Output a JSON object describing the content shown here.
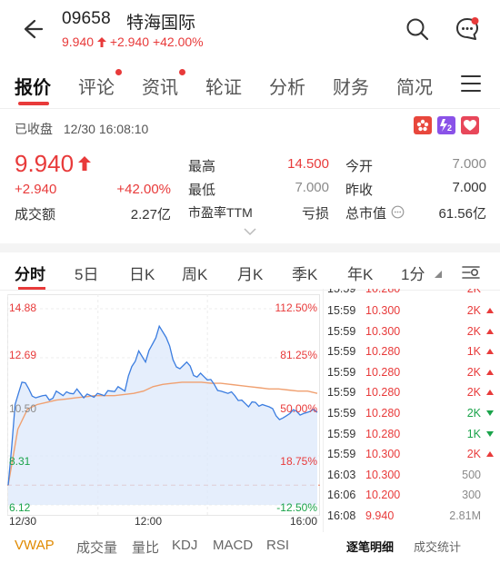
{
  "header": {
    "code": "09658",
    "name": "特海国际",
    "price": "9.940",
    "change": "+2.940",
    "change_pct": "+42.00%"
  },
  "tabs": [
    "报价",
    "评论",
    "资讯",
    "轮证",
    "分析",
    "财务",
    "简况"
  ],
  "status": {
    "text": "已收盘",
    "datetime": "12/30 16:08:10"
  },
  "quote": {
    "price": "9.940",
    "change": "+2.940",
    "change_pct": "+42.00%",
    "turnover_label": "成交额",
    "turnover": "2.27亿",
    "high_label": "最高",
    "high": "14.500",
    "low_label": "最低",
    "low": "7.000",
    "pe_label": "市盈率TTM",
    "pe": "亏损",
    "open_label": "今开",
    "open": "7.000",
    "prev_close_label": "昨收",
    "prev_close": "7.000",
    "mktcap_label": "总市值",
    "mktcap": "61.56亿"
  },
  "period_tabs": [
    "分时",
    "5日",
    "日K",
    "周K",
    "月K",
    "季K",
    "年K",
    "1分"
  ],
  "chart": {
    "left_labels": [
      "14.88",
      "12.69",
      "10.50",
      "8.31",
      "6.12"
    ],
    "right_labels": [
      "112.50%",
      "81.25%",
      "50.00%",
      "18.75%",
      "-12.50%"
    ],
    "time_labels": [
      "12/30",
      "12:00",
      "16:00"
    ]
  },
  "chart_data": {
    "type": "line",
    "title": "",
    "ylim": [
      6.12,
      14.88
    ],
    "y2lim": [
      "-12.50%",
      "112.50%"
    ],
    "prev_close": 7.0,
    "x_range": [
      "09:30",
      "16:00"
    ],
    "series": [
      {
        "values": [
          7.0,
          10.6,
          11.6,
          11.3,
          10.9,
          11.0,
          10.8,
          11.2,
          11.0,
          11.1,
          11.3,
          10.9,
          11.0,
          11.1,
          11.0,
          11.2,
          11.4,
          11.2,
          12.3,
          13.0,
          12.5,
          13.3,
          14.1,
          13.6,
          12.6,
          12.2,
          12.5,
          11.9,
          12.0,
          11.7,
          11.5,
          11.2,
          11.1,
          11.0,
          10.8,
          10.5,
          10.7,
          10.6,
          10.5,
          10.1,
          10.0,
          10.2,
          10.3,
          10.2,
          10.3,
          10.25
        ]
      },
      {
        "values": [
          7.0,
          9.5,
          10.4,
          10.6,
          10.7,
          10.8,
          10.85,
          10.9,
          10.95,
          11.0,
          11.0,
          11.0,
          11.05,
          11.1,
          11.2,
          11.4,
          11.5,
          11.55,
          11.6,
          11.6,
          11.6,
          11.55,
          11.55,
          11.5,
          11.45,
          11.4,
          11.35,
          11.3,
          11.3,
          11.25,
          11.2,
          11.2,
          11.1
        ]
      }
    ]
  },
  "trades": {
    "rows": [
      {
        "time": "15:59",
        "price": "10.300",
        "vol": "2K",
        "dir": "up",
        "pc": "red",
        "vc": "red"
      },
      {
        "time": "15:59",
        "price": "10.300",
        "vol": "2K",
        "dir": "up",
        "pc": "red",
        "vc": "red"
      },
      {
        "time": "15:59",
        "price": "10.280",
        "vol": "1K",
        "dir": "up",
        "pc": "red",
        "vc": "red"
      },
      {
        "time": "15:59",
        "price": "10.280",
        "vol": "2K",
        "dir": "up",
        "pc": "red",
        "vc": "red"
      },
      {
        "time": "15:59",
        "price": "10.280",
        "vol": "2K",
        "dir": "up",
        "pc": "red",
        "vc": "red"
      },
      {
        "time": "15:59",
        "price": "10.280",
        "vol": "2K",
        "dir": "down",
        "pc": "red",
        "vc": "green"
      },
      {
        "time": "15:59",
        "price": "10.280",
        "vol": "1K",
        "dir": "down",
        "pc": "red",
        "vc": "green"
      },
      {
        "time": "15:59",
        "price": "10.300",
        "vol": "2K",
        "dir": "up",
        "pc": "red",
        "vc": "red"
      },
      {
        "time": "16:03",
        "price": "10.300",
        "vol": "500",
        "dir": "neutral",
        "pc": "red",
        "vc": "gray"
      },
      {
        "time": "16:06",
        "price": "10.200",
        "vol": "300",
        "dir": "neutral",
        "pc": "red",
        "vc": "gray"
      },
      {
        "time": "16:08",
        "price": "9.940",
        "vol": "2.81M",
        "dir": "neutral",
        "pc": "red",
        "vc": "gray"
      }
    ],
    "tabs": [
      "逐笔明细",
      "成交统计"
    ]
  },
  "indicators": [
    "VWAP",
    "成交量",
    "量比",
    "KDJ",
    "MACD",
    "RSI"
  ],
  "colors": {
    "up": "#e83a3a",
    "down": "#1aa34a",
    "price_line": "#3b7de0",
    "avg_line": "#f0a070",
    "fill": "#dce8fb"
  }
}
